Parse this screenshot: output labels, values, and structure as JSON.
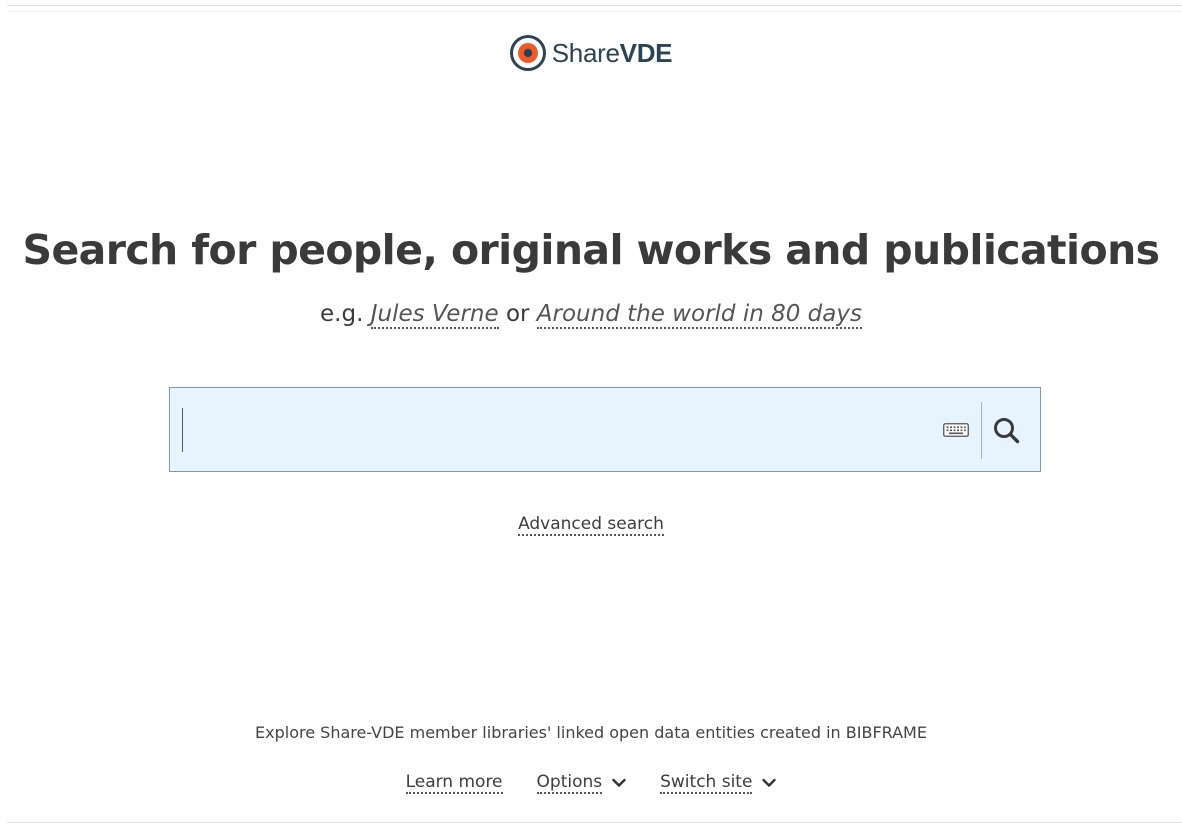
{
  "brand": {
    "name_light": "Share",
    "name_bold": "VDE",
    "logo_outer_color": "#2c4452",
    "logo_inner_color": "#f05a28"
  },
  "hero": {
    "headline": "Search for people, original works and publications",
    "examples_prefix": "e.g.",
    "example_1": "Jules Verne",
    "examples_joiner": "or",
    "example_2": "Around the world in 80 days"
  },
  "search": {
    "value": "",
    "placeholder": "",
    "keyboard_icon": "keyboard-icon",
    "submit_icon": "search-icon",
    "background": "#e8f4fd",
    "border": "#7c99b0"
  },
  "links": {
    "advanced_search": "Advanced search"
  },
  "footer": {
    "explore_text": "Explore Share-VDE member libraries' linked open data entities created in BIBFRAME",
    "learn_more": "Learn more",
    "options": "Options",
    "switch_site": "Switch site"
  }
}
